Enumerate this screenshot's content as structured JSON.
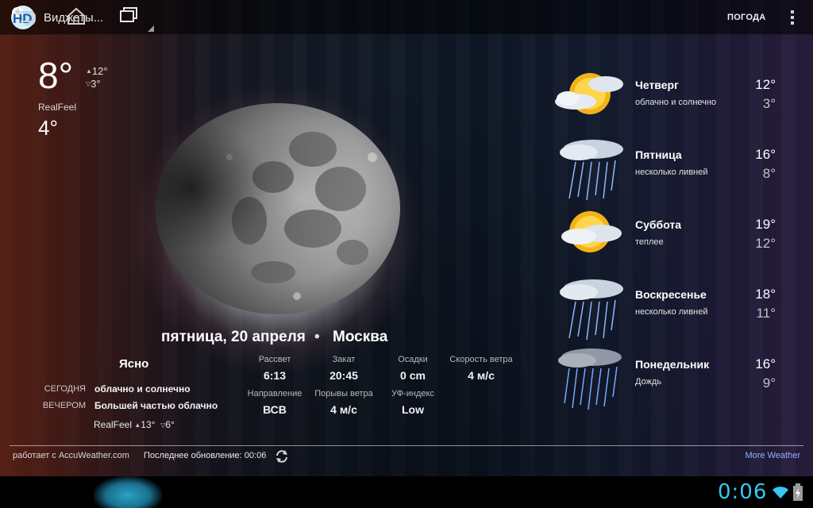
{
  "actionbar": {
    "title": "Виджеты...",
    "app_icon_letters": "HD",
    "weather_button": "ПОГОДА",
    "icon_overflow": "overflow-menu-icon"
  },
  "current": {
    "temp": "8°",
    "high": "12°",
    "low": "3°",
    "realfeel_label": "RealFeel",
    "realfeel": "4°",
    "moon_icon": "moon-phase-icon"
  },
  "summary": {
    "date": "пятница, 20 апреля",
    "separator": "•",
    "city": "Москва",
    "condition": "Ясно",
    "today_label": "СЕГОДНЯ",
    "today_text": "облачно и солнечно",
    "evening_label": "ВЕЧЕРОМ",
    "evening_text": "Большей частью облачно",
    "evening_realfeel_label": "RealFeel",
    "evening_high": "13°",
    "evening_low": "6°"
  },
  "stats": [
    {
      "label": "Рассвет",
      "value": "6:13"
    },
    {
      "label": "Закат",
      "value": "20:45"
    },
    {
      "label": "Осадки",
      "value": "0 cm"
    },
    {
      "label": "Скорость ветра",
      "value": "4 м/с"
    },
    {
      "label": "Направление",
      "value": "ВСВ"
    },
    {
      "label": "Порывы ветра",
      "value": "4 м/с"
    },
    {
      "label": "УФ-индекс",
      "value": "Low"
    }
  ],
  "forecast": [
    {
      "day": "Четверг",
      "desc": "облачно и солнечно",
      "hi": "12°",
      "lo": "3°",
      "icon": "partly-sunny-icon"
    },
    {
      "day": "Пятница",
      "desc": "несколько ливней",
      "hi": "16°",
      "lo": "8°",
      "icon": "rain-showers-icon"
    },
    {
      "day": "Суббота",
      "desc": "теплее",
      "hi": "19°",
      "lo": "12°",
      "icon": "partly-sunny-icon"
    },
    {
      "day": "Воскресенье",
      "desc": "несколько ливней",
      "hi": "18°",
      "lo": "11°",
      "icon": "rain-showers-icon"
    },
    {
      "day": "Понедельник",
      "desc": "Дождь",
      "hi": "16°",
      "lo": "9°",
      "icon": "rain-icon"
    }
  ],
  "footer": {
    "source": "работает с AccuWeather.com",
    "updated": "Последнее обновление: 00:06",
    "more": "More Weather",
    "refresh_icon": "refresh-icon"
  },
  "system": {
    "clock": "0:06",
    "icons": [
      "back-icon",
      "home-icon",
      "recent-apps-icon",
      "wifi-icon",
      "battery-icon"
    ]
  },
  "colors": {
    "accent_clock": "#36c8f0",
    "link": "#8fb0ff"
  }
}
